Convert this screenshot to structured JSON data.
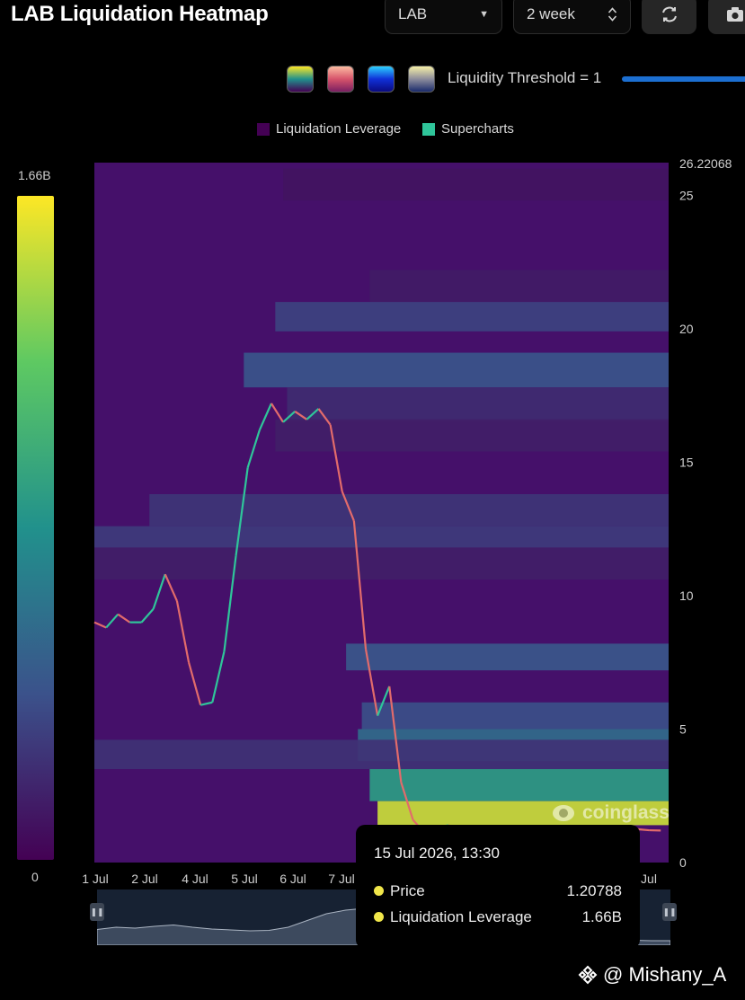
{
  "header": {
    "title": "LAB Liquidation Heatmap",
    "symbol_select": "LAB",
    "range_select": "2 week",
    "refresh_icon": "refresh-icon",
    "camera_icon": "camera-icon"
  },
  "controls": {
    "palettes": [
      {
        "name": "viridis",
        "colors": [
          "#fde725",
          "#21918c",
          "#440154"
        ]
      },
      {
        "name": "magma",
        "colors": [
          "#fcbba1",
          "#d6536b",
          "#7a1f62"
        ]
      },
      {
        "name": "blue",
        "colors": [
          "#2bd0ff",
          "#1030d8",
          "#0a0a80"
        ]
      },
      {
        "name": "yellow-blue",
        "colors": [
          "#f6f0a8",
          "#8c8c9c",
          "#1a2a6c"
        ]
      }
    ],
    "threshold_label": "Liquidity Threshold = 1",
    "slider_color": "#1c6fd1"
  },
  "legend": {
    "items": [
      {
        "label": "Liquidation Leverage",
        "color": "#440154"
      },
      {
        "label": "Supercharts",
        "color": "#2fc59a"
      }
    ]
  },
  "colorbar": {
    "max_label": "1.66B",
    "min_label": "0"
  },
  "chart_data": {
    "type": "heatmap",
    "title": "LAB Liquidation Heatmap",
    "ylim": [
      0,
      26.22068
    ],
    "y_max_label": "26.22068",
    "y_ticks": [
      "25",
      "20",
      "15",
      "10",
      "5",
      "0"
    ],
    "x_ticks": [
      "1 Jul",
      "2 Jul",
      "4 Jul",
      "5 Jul",
      "6 Jul",
      "7 Jul",
      "Jul"
    ],
    "x_range_days": [
      0,
      14.6
    ],
    "colorscale": [
      "#440154",
      "#3b528b",
      "#21918c",
      "#5ec962",
      "#fde725"
    ],
    "liquidity_bands": [
      {
        "y_low": 24.8,
        "y_high": 26.0,
        "x_start": 4.8,
        "level": 0.06
      },
      {
        "y_low": 21.0,
        "y_high": 22.2,
        "x_start": 7.0,
        "level": 0.08
      },
      {
        "y_low": 19.9,
        "y_high": 21.0,
        "x_start": 4.6,
        "level": 0.2
      },
      {
        "y_low": 17.8,
        "y_high": 19.1,
        "x_start": 3.8,
        "level": 0.26
      },
      {
        "y_low": 16.5,
        "y_high": 17.8,
        "x_start": 4.9,
        "level": 0.13
      },
      {
        "y_low": 15.4,
        "y_high": 16.6,
        "x_start": 4.6,
        "level": 0.09
      },
      {
        "y_low": 12.6,
        "y_high": 13.8,
        "x_start": 1.4,
        "level": 0.16
      },
      {
        "y_low": 11.8,
        "y_high": 12.6,
        "x_start": 0.0,
        "level": 0.18
      },
      {
        "y_low": 10.6,
        "y_high": 11.8,
        "x_start": 0.0,
        "level": 0.09
      },
      {
        "y_low": 7.2,
        "y_high": 8.2,
        "x_start": 6.4,
        "level": 0.27
      },
      {
        "y_low": 5.0,
        "y_high": 6.0,
        "x_start": 6.8,
        "level": 0.24
      },
      {
        "y_low": 3.8,
        "y_high": 5.0,
        "x_start": 6.7,
        "level": 0.35
      },
      {
        "y_low": 3.5,
        "y_high": 4.6,
        "x_start": 0.0,
        "level": 0.15
      },
      {
        "y_low": 2.3,
        "y_high": 3.5,
        "x_start": 7.0,
        "level": 0.55
      },
      {
        "y_low": 1.4,
        "y_high": 2.3,
        "x_start": 7.2,
        "level": 0.92
      }
    ],
    "price_series": {
      "name": "Price",
      "x_days": [
        0,
        0.3,
        0.6,
        0.9,
        1.2,
        1.5,
        1.8,
        2.1,
        2.4,
        2.7,
        3.0,
        3.3,
        3.6,
        3.9,
        4.2,
        4.5,
        4.8,
        5.1,
        5.4,
        5.7,
        6.0,
        6.3,
        6.6,
        6.9,
        7.2,
        7.5,
        7.8,
        8.1,
        8.4,
        8.7,
        9.0,
        9.3,
        9.6,
        9.9,
        10.2,
        10.5,
        10.8,
        11.1,
        11.4,
        11.7,
        12.0,
        12.3,
        12.6,
        12.9,
        13.2,
        13.5,
        13.8,
        14.1,
        14.4
      ],
      "y": [
        9.0,
        8.8,
        9.3,
        9.0,
        9.0,
        9.5,
        10.8,
        9.8,
        7.5,
        5.9,
        6.0,
        7.9,
        11.5,
        14.8,
        16.2,
        17.2,
        16.5,
        16.9,
        16.6,
        17.0,
        16.4,
        13.9,
        12.8,
        8.0,
        5.5,
        6.6,
        3.0,
        1.6,
        1.1,
        1.3,
        1.4,
        1.2,
        1.1,
        1.3,
        1.2,
        1.25,
        1.3,
        1.15,
        1.2,
        1.1,
        1.2,
        1.25,
        1.15,
        1.2,
        1.3,
        1.2,
        1.25,
        1.21,
        1.2
      ],
      "up_color": "#2fc59a",
      "down_color": "#e26b6b"
    },
    "navigator_profile": [
      0.35,
      0.4,
      0.38,
      0.42,
      0.45,
      0.4,
      0.36,
      0.34,
      0.32,
      0.33,
      0.4,
      0.55,
      0.7,
      0.78,
      0.82,
      0.84,
      0.83,
      0.85,
      0.84,
      0.86,
      0.82,
      0.72,
      0.52,
      0.3,
      0.18,
      0.12,
      0.1,
      0.1,
      0.11,
      0.1,
      0.1
    ]
  },
  "tooltip": {
    "title": "15 Jul 2026, 13:30",
    "rows": [
      {
        "name": "Price",
        "value": "1.20788",
        "color": "#f0e64a"
      },
      {
        "name": "Liquidation Leverage",
        "value": "1.66B",
        "color": "#f0e64a"
      }
    ]
  },
  "brand": {
    "text": "coinglass"
  },
  "watermark": {
    "text": "@ Mishany_A"
  }
}
